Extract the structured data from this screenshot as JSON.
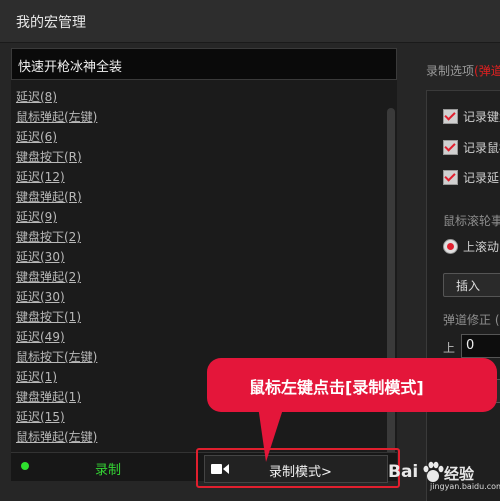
{
  "window": {
    "title": "我的宏管理"
  },
  "macro": {
    "name": "快速开枪冰神全装",
    "steps": [
      "延迟(8)",
      "鼠标弹起(左键)",
      "延迟(6)",
      "键盘按下(R)",
      "延迟(12)",
      "键盘弹起(R)",
      "延迟(9)",
      "键盘按下(2)",
      "延迟(30)",
      "键盘弹起(2)",
      "延迟(30)",
      "键盘按下(1)",
      "延迟(49)",
      "鼠标按下(左键)",
      "延迟(1)",
      "键盘弹起(1)",
      "延迟(15)",
      "鼠标弹起(左键)"
    ]
  },
  "record": {
    "label": "录制",
    "mode_label": "录制模式>"
  },
  "options": {
    "header_prefix": "录制选项",
    "header_accent": "(弹道",
    "checkboxes": [
      "记录键盘",
      "记录鼠标",
      "记录延时"
    ],
    "wheel_label": "鼠标滚轮事",
    "radio_label": "上滚动",
    "insert_label": "插入",
    "recoil_label": "弹道修正 (",
    "up_label": "上",
    "up_value": "0",
    "small_button_label": "入"
  },
  "callout": {
    "text": "鼠标左键点击[录制模式]"
  },
  "watermark": {
    "brand": "Bai",
    "suffix": "经验",
    "url": "jingyan.baidu.com"
  },
  "colors": {
    "accent_red": "#e4163a",
    "record_green": "#34d534",
    "background": "#262626"
  }
}
